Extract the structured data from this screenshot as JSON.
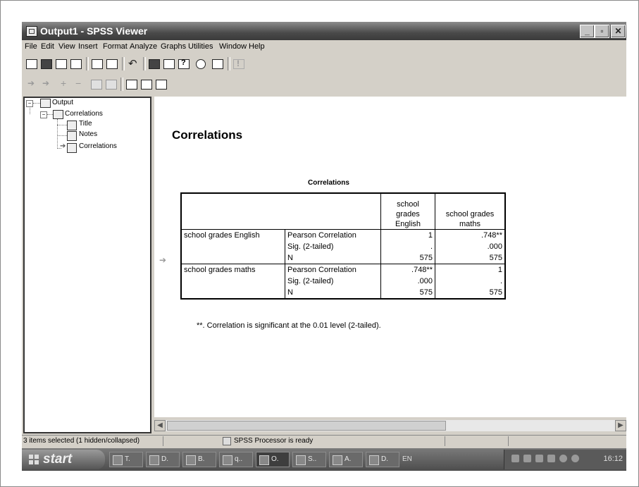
{
  "window": {
    "title": "Output1 - SPSS Viewer",
    "controls": {
      "minimize": "_",
      "maximize": "▫",
      "close": "✕"
    }
  },
  "menubar": {
    "items": [
      "File",
      "Edit",
      "View",
      "Insert",
      "Format",
      "Analyze",
      "Graphs",
      "Utilities",
      "Window",
      "Help"
    ]
  },
  "toolbar1": {
    "icons": [
      "open-icon",
      "save-icon",
      "print-icon",
      "print-preview-icon",
      "export-icon",
      "recall-dialog-icon",
      "undo-icon",
      "goto-data-icon",
      "goto-case-icon",
      "variables-icon",
      "use-sets-icon",
      "designate-window-icon",
      "run-icon"
    ]
  },
  "toolbar2": {
    "icons": [
      "promote-icon",
      "demote-icon",
      "expand-icon",
      "collapse-icon",
      "show-icon",
      "hide-icon",
      "insert-heading-icon",
      "insert-title-icon",
      "insert-text-icon"
    ]
  },
  "outline": {
    "items": [
      "Output",
      "Correlations",
      "Title",
      "Notes",
      "Correlations"
    ]
  },
  "contents": {
    "heading": "Correlations",
    "table": {
      "caption": "Correlations",
      "col_headers": [
        "school grades English",
        "school grades maths"
      ],
      "col_header_lines": [
        [
          "school",
          "grades",
          "English"
        ],
        [
          "school grades",
          "maths"
        ]
      ],
      "rows": [
        {
          "group": "school grades English",
          "stat": "Pearson Correlation",
          "v1": "1",
          "v2": ".748**"
        },
        {
          "group": "",
          "stat": "Sig. (2-tailed)",
          "v1": ".",
          "v2": ".000"
        },
        {
          "group": "",
          "stat": "N",
          "v1": "575",
          "v2": "575"
        },
        {
          "group": "school grades maths",
          "stat": "Pearson Correlation",
          "v1": ".748**",
          "v2": "1"
        },
        {
          "group": "",
          "stat": "Sig. (2-tailed)",
          "v1": ".000",
          "v2": "."
        },
        {
          "group": "",
          "stat": "N",
          "v1": "575",
          "v2": "575"
        }
      ],
      "footnote": "**. Correlation is significant at the 0.01 level (2-tailed)."
    }
  },
  "statusbar": {
    "selection": "3 items selected (1 hidden/collapsed)",
    "processor": "SPSS Processor  is ready"
  },
  "taskbar": {
    "start": "start",
    "tasks": [
      "T.",
      "D.",
      "B.",
      "q..",
      "O.",
      "S..",
      "A.",
      "D."
    ],
    "language": "EN",
    "clock": "16:12"
  }
}
